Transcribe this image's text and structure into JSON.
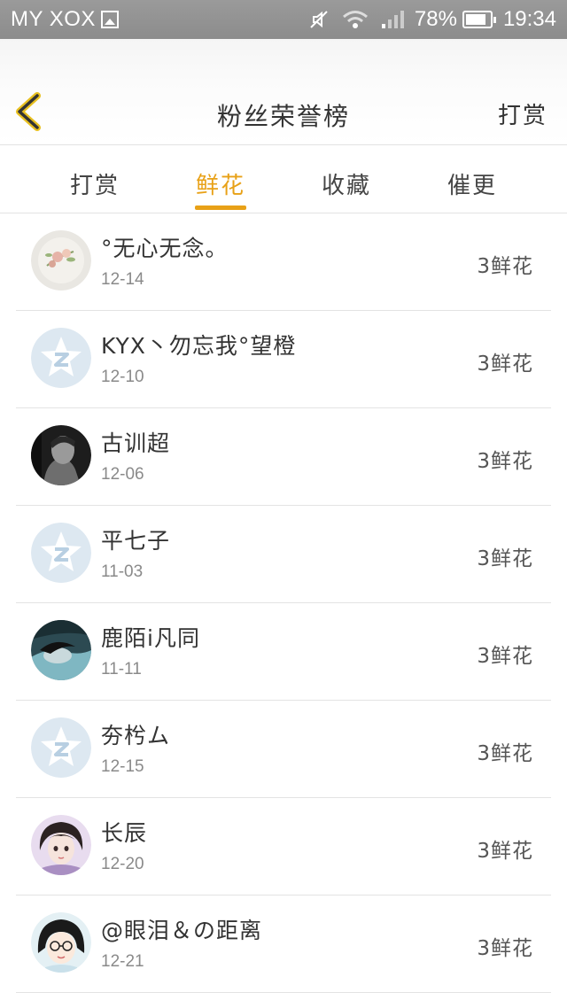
{
  "status_bar": {
    "carrier": "MY XOX",
    "battery_percent": "78%",
    "time": "19:34"
  },
  "header": {
    "title": "粉丝荣誉榜",
    "action_label": "打赏",
    "accent_color": "#e8a117"
  },
  "tabs": [
    {
      "label": "打赏",
      "active": false
    },
    {
      "label": "鲜花",
      "active": true
    },
    {
      "label": "收藏",
      "active": false
    },
    {
      "label": "催更",
      "active": false
    }
  ],
  "fans": [
    {
      "name": "°无心无念。",
      "date": "12-14",
      "count": "3鲜花",
      "avatar": "flower-avatar"
    },
    {
      "name": "KYX丶勿忘我°望橙",
      "date": "12-10",
      "count": "3鲜花",
      "avatar": "default-qzone-avatar"
    },
    {
      "name": "古训超",
      "date": "12-06",
      "count": "3鲜花",
      "avatar": "man-portrait-avatar"
    },
    {
      "name": "平七子",
      "date": "11-03",
      "count": "3鲜花",
      "avatar": "default-qzone-avatar"
    },
    {
      "name": "鹿陌i凡同",
      "date": "11-11",
      "count": "3鲜花",
      "avatar": "sleeping-person-avatar"
    },
    {
      "name": "夯枍ム",
      "date": "12-15",
      "count": "3鲜花",
      "avatar": "default-qzone-avatar"
    },
    {
      "name": "长辰",
      "date": "12-20",
      "count": "3鲜花",
      "avatar": "anime-girl-avatar"
    },
    {
      "name": "@眼泪＆の距离",
      "date": "12-21",
      "count": "3鲜花",
      "avatar": "cartoon-glasses-girl-avatar"
    }
  ]
}
